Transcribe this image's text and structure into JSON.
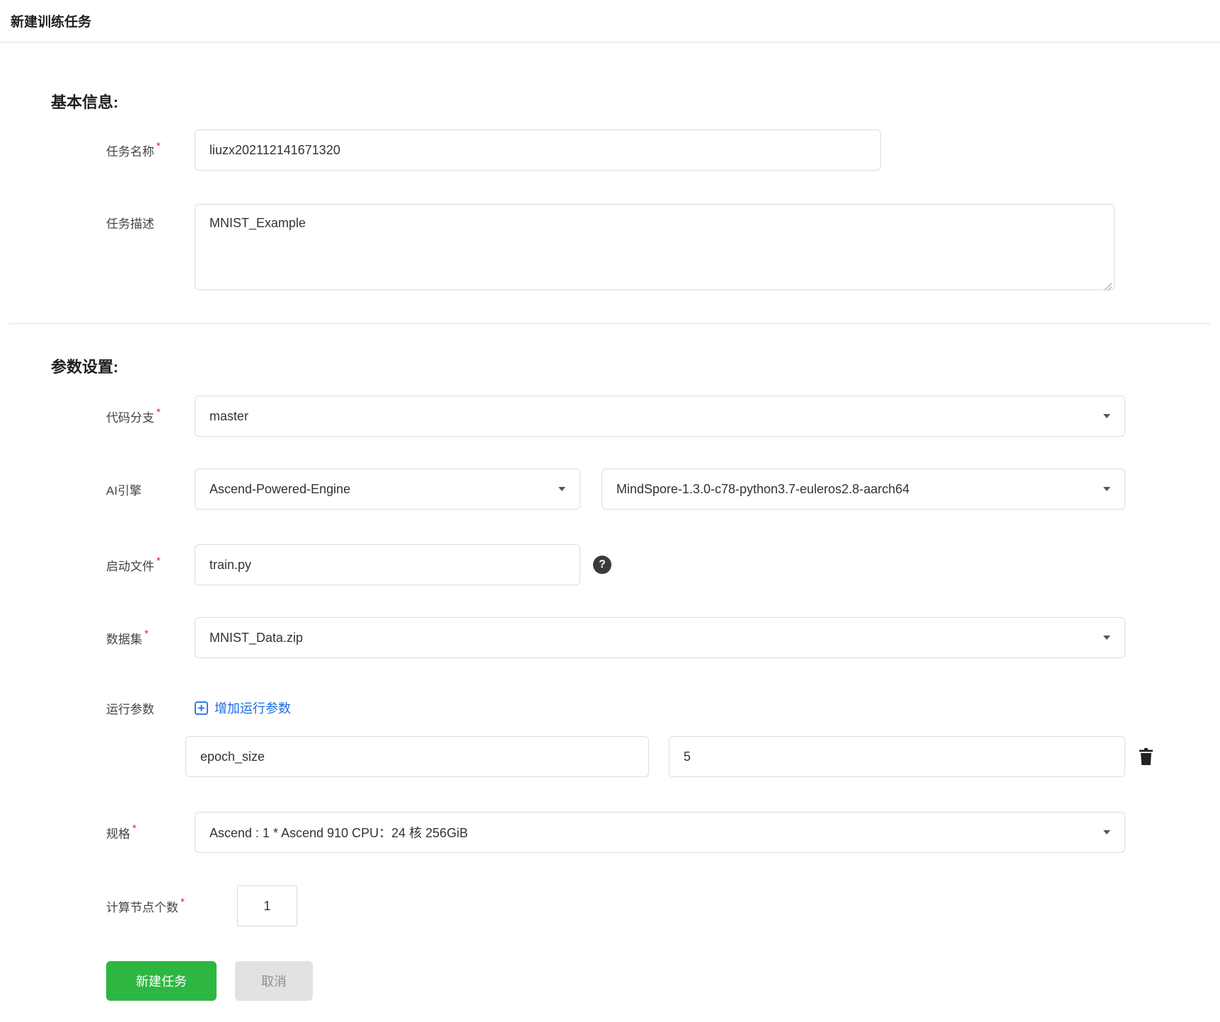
{
  "page": {
    "title": "新建训练任务"
  },
  "sections": {
    "basic": "基本信息:",
    "params": "参数设置:"
  },
  "fields": {
    "task_name": {
      "label": "任务名称",
      "required": true,
      "value": "liuzx202112141671320"
    },
    "task_desc": {
      "label": "任务描述",
      "required": false,
      "value": "MNIST_Example"
    },
    "code_branch": {
      "label": "代码分支",
      "required": true,
      "value": "master"
    },
    "ai_engine": {
      "label": "AI引擎",
      "required": false,
      "engine": "Ascend-Powered-Engine",
      "version": "MindSpore-1.3.0-c78-python3.7-euleros2.8-aarch64"
    },
    "boot_file": {
      "label": "启动文件",
      "required": true,
      "value": "train.py"
    },
    "dataset": {
      "label": "数据集",
      "required": true,
      "value": "MNIST_Data.zip"
    },
    "run_params": {
      "label": "运行参数",
      "required": false,
      "add_link_label": "增加运行参数",
      "rows": [
        {
          "key": "epoch_size",
          "value": "5"
        }
      ]
    },
    "spec": {
      "label": "规格",
      "required": true,
      "value": "Ascend : 1 * Ascend 910 CPU：24 核 256GiB"
    },
    "node_count": {
      "label": "计算节点个数",
      "required": true,
      "value": "1"
    }
  },
  "buttons": {
    "submit": "新建任务",
    "cancel": "取消"
  },
  "icons": {
    "help": "?",
    "required": "*",
    "add_param": "plus-square",
    "delete_param": "trash",
    "dropdown": "caret-down"
  },
  "colors": {
    "primary_green": "#2DB742",
    "link_blue": "#1B6BE8",
    "required_red": "#E02B2B"
  }
}
